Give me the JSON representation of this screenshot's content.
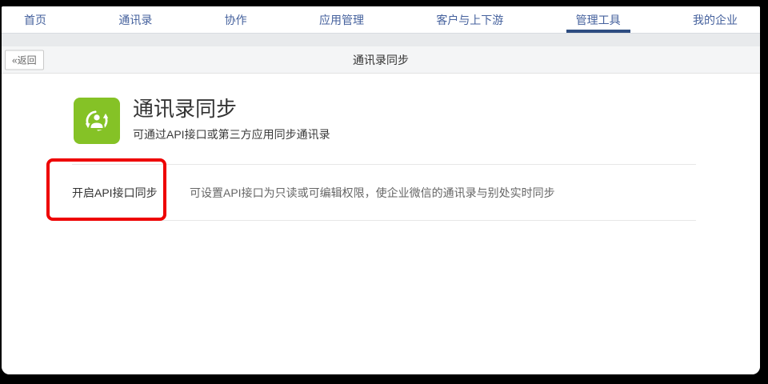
{
  "nav": {
    "items": [
      {
        "label": "首页",
        "active": false
      },
      {
        "label": "通讯录",
        "active": false
      },
      {
        "label": "协作",
        "active": false
      },
      {
        "label": "应用管理",
        "active": false
      },
      {
        "label": "客户与上下游",
        "active": false
      },
      {
        "label": "管理工具",
        "active": true
      },
      {
        "label": "我的企业",
        "active": false
      }
    ]
  },
  "toolbar": {
    "back_label": "«返回",
    "title": "通讯录同步"
  },
  "app": {
    "icon": "person-sync-icon",
    "title": "通讯录同步",
    "subtitle": "可通过API接口或第三方应用同步通讯录"
  },
  "settings_row": {
    "label": "开启API接口同步",
    "description": "可设置API接口为只读或可编辑权限，使企业微信的通讯录与别处实时同步"
  },
  "colors": {
    "accent_green": "#85c226",
    "annotation_red": "#ee0000",
    "nav_blue": "#45619d",
    "nav_active_underline": "#2d4c80"
  }
}
